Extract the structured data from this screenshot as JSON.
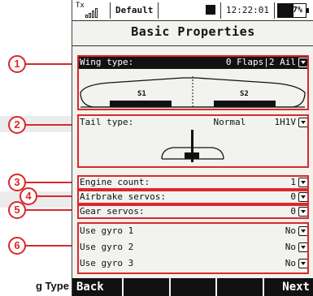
{
  "background": {
    "caption": "g Type"
  },
  "callouts": [
    "1",
    "2",
    "3",
    "4",
    "5",
    "6"
  ],
  "status_bar": {
    "tx_label": "Tx",
    "model_name": "Default",
    "time": "12:22:01",
    "battery_text": "57%",
    "battery_level": 0.57
  },
  "title": "Basic Properties",
  "wing": {
    "label": "Wing type:",
    "value": "0 Flaps|2 Ail",
    "servo_left": "S1",
    "servo_right": "S2"
  },
  "tail": {
    "label": "Tail type:",
    "value": "Normal",
    "value2": "1H1V"
  },
  "settings": [
    {
      "label": "Engine count:",
      "value": "1"
    },
    {
      "label": "Airbrake servos:",
      "value": "0"
    },
    {
      "label": "Gear servos:",
      "value": "0"
    }
  ],
  "gyros": [
    {
      "label": "Use gyro 1",
      "value": "No"
    },
    {
      "label": "Use gyro 2",
      "value": "No"
    },
    {
      "label": "Use gyro 3",
      "value": "No"
    }
  ],
  "softkeys": [
    "Back",
    "",
    "",
    "",
    "Next"
  ],
  "colors": {
    "callout": "#d9292b",
    "screen_bg": "#f2f2ef",
    "selection": "#111111"
  }
}
